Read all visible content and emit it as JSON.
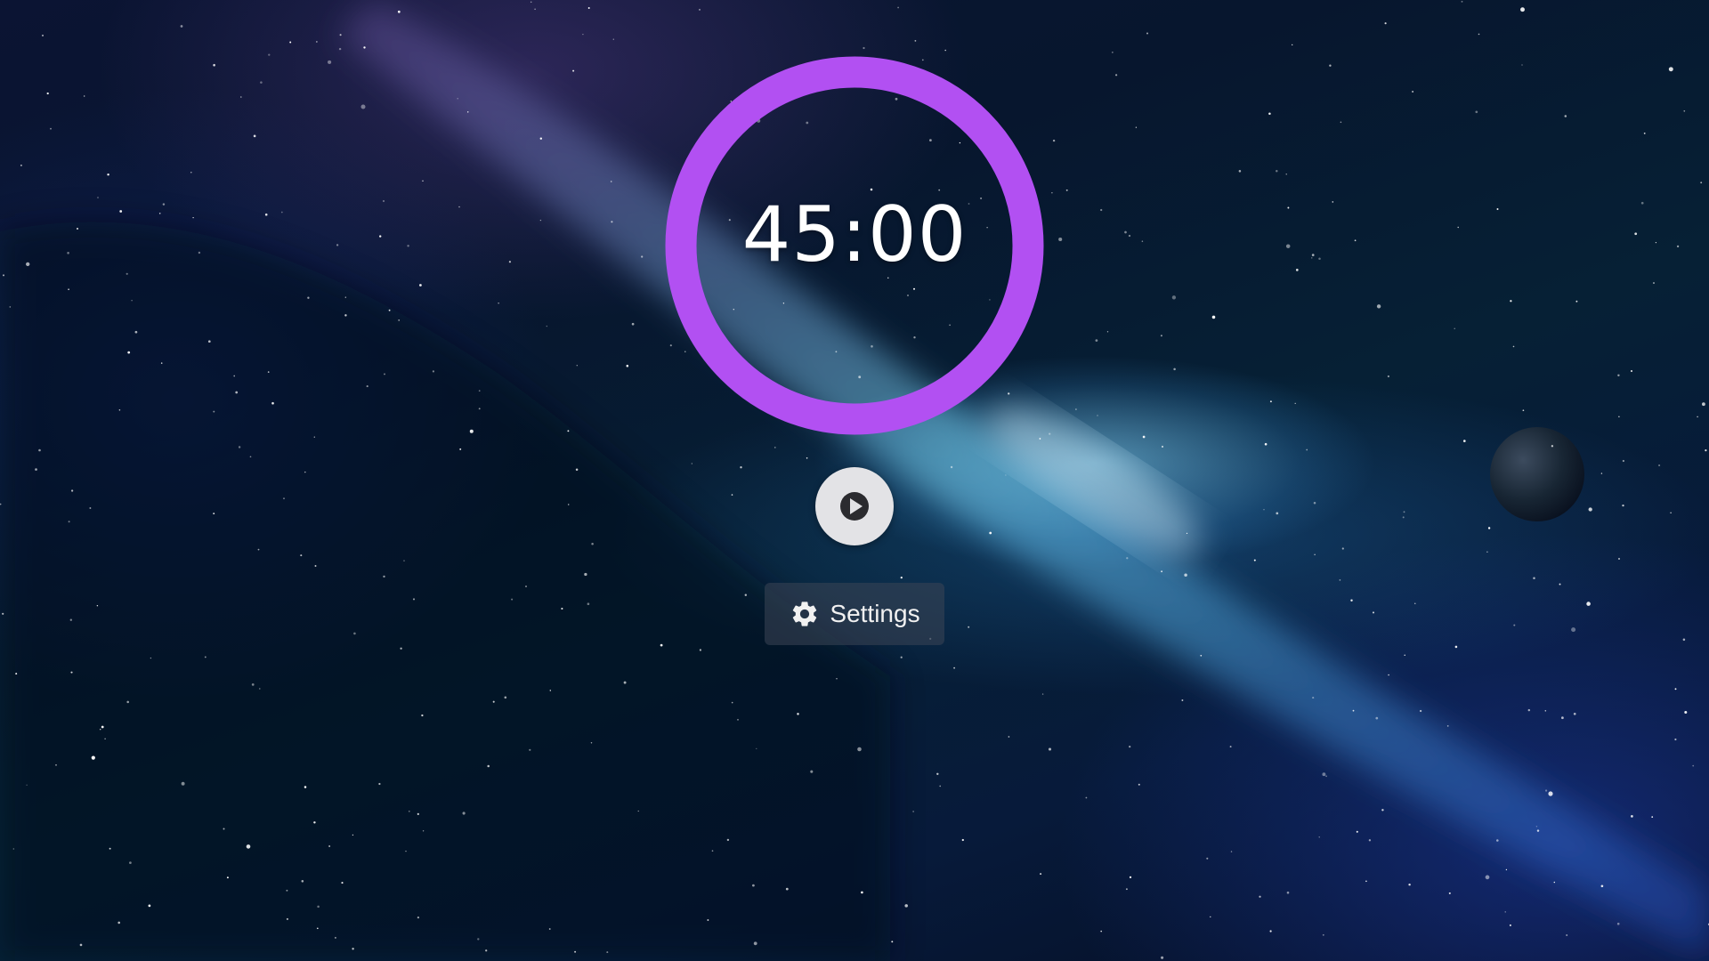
{
  "timer": {
    "time_display": "45:00",
    "ring_color": "#b250f2",
    "progress": 1.0
  },
  "controls": {
    "play_icon": "play-icon",
    "settings_label": "Settings",
    "settings_icon": "gear-icon"
  },
  "background": {
    "theme": "milky-way-space"
  }
}
